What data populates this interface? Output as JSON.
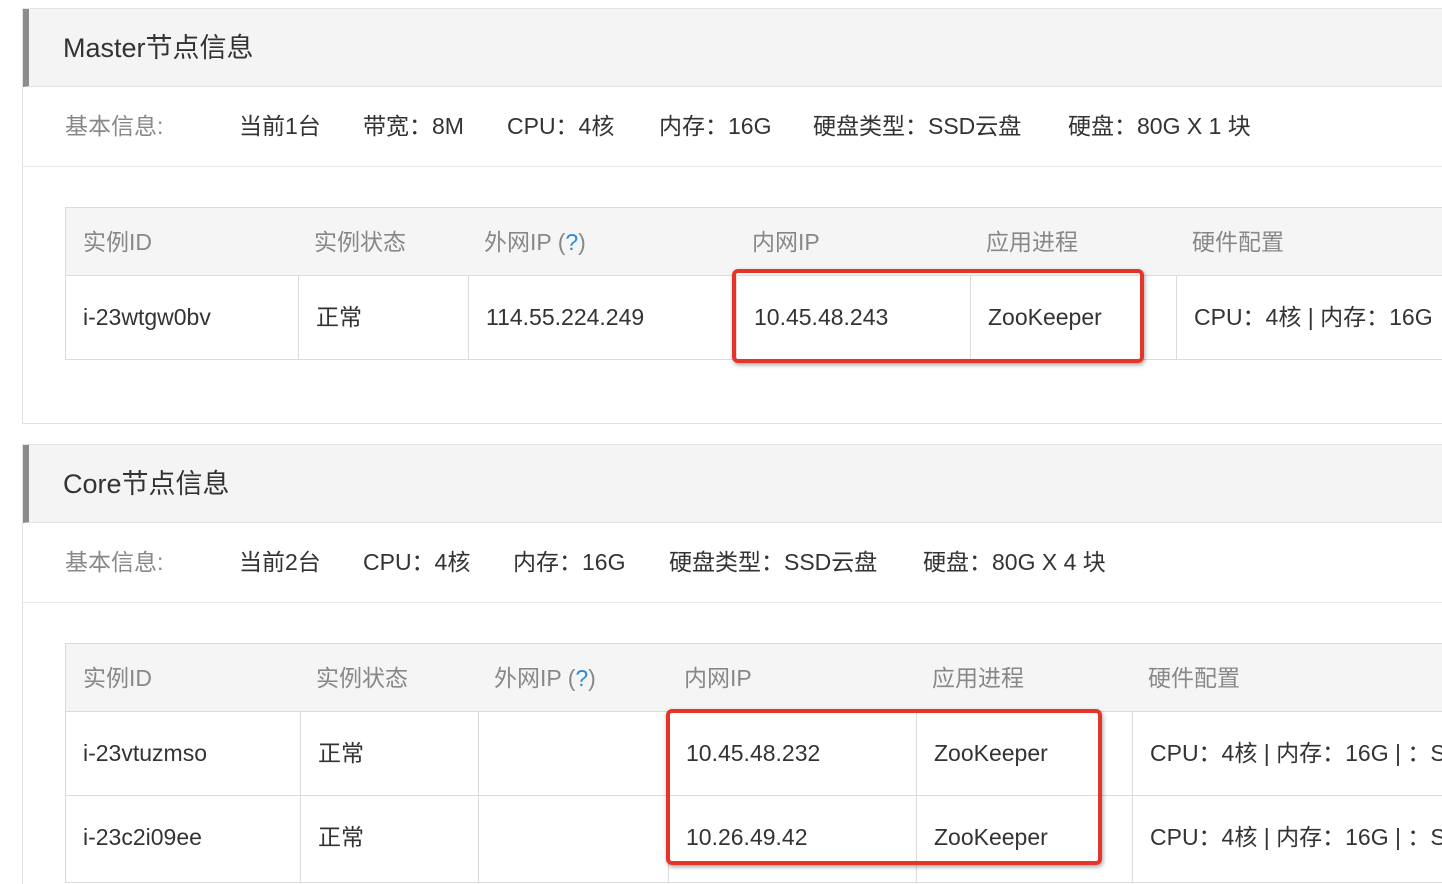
{
  "master": {
    "title": "Master节点信息",
    "basic_label": "基本信息:",
    "basic_items": [
      "当前1台",
      "带宽：8M",
      "CPU：4核",
      "内存：16G",
      "硬盘类型：SSD云盘",
      "硬盘：80G X 1 块"
    ],
    "columns": {
      "instance_id": "实例ID",
      "status": "实例状态",
      "public_ip": "外网IP (",
      "help": "?",
      "close_paren": ")",
      "private_ip": "内网IP",
      "process": "应用进程",
      "hardware": "硬件配置"
    },
    "rows": [
      {
        "instance_id": "i-23wtgw0bv",
        "status": "正常",
        "public_ip": "114.55.224.249",
        "private_ip": "10.45.48.243",
        "process": "ZooKeeper",
        "hardware": "CPU：4核 | 内存：16G"
      }
    ]
  },
  "core": {
    "title": "Core节点信息",
    "basic_label": "基本信息:",
    "basic_items": [
      "当前2台",
      "CPU：4核",
      "内存：16G",
      "硬盘类型：SSD云盘",
      "硬盘：80G X 4 块"
    ],
    "columns": {
      "instance_id": "实例ID",
      "status": "实例状态",
      "public_ip": "外网IP (",
      "help": "?",
      "close_paren": ")",
      "private_ip": "内网IP",
      "process": "应用进程",
      "hardware": "硬件配置"
    },
    "rows": [
      {
        "instance_id": "i-23vtuzmso",
        "status": "正常",
        "public_ip": "",
        "private_ip": "10.45.48.232",
        "process": "ZooKeeper",
        "hardware": "CPU：4核 | 内存：16G | ：S"
      },
      {
        "instance_id": "i-23c2i09ee",
        "status": "正常",
        "public_ip": "",
        "private_ip": "10.26.49.42",
        "process": "ZooKeeper",
        "hardware": "CPU：4核 | 内存：16G | ：S"
      }
    ]
  },
  "colors": {
    "highlight": "#e5342a",
    "help_link": "#2e8bd6",
    "header_bg": "#f4f4f4",
    "muted_text": "#888888"
  }
}
